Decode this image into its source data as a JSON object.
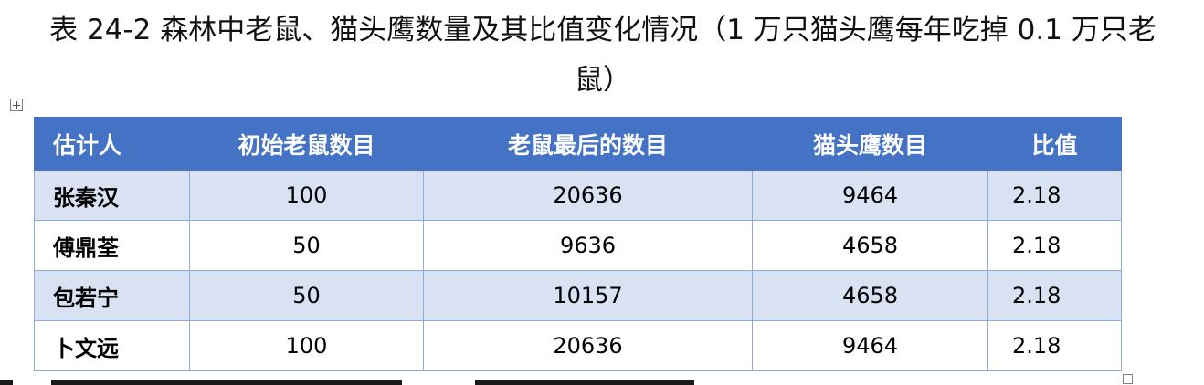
{
  "caption": "表 24-2 森林中老鼠、猫头鹰数量及其比值变化情况（1 万只猫头鹰每年吃掉 0.1 万只老鼠）",
  "table": {
    "headers": [
      "估计人",
      "初始老鼠数目",
      "老鼠最后的数目",
      "猫头鹰数目",
      "比值"
    ],
    "rows": [
      [
        "张秦汉",
        "100",
        "20636",
        "9464",
        "2.18"
      ],
      [
        "傅鼎荃",
        "50",
        "9636",
        "4658",
        "2.18"
      ],
      [
        "包若宁",
        "50",
        "10157",
        "4658",
        "2.18"
      ],
      [
        "卜文远",
        "100",
        "20636",
        "9464",
        "2.18"
      ]
    ],
    "header_color": "#4472c4",
    "band_color": "#d9e2f3",
    "border_color": "#8eaadb"
  },
  "icons": {
    "table_anchor": "move-handle-icon",
    "table_resize": "resize-handle-icon"
  }
}
